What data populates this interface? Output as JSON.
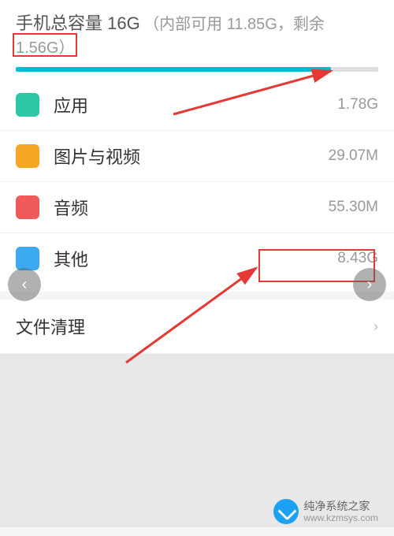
{
  "header": {
    "title": "手机总容量 16G",
    "sub_prefix": "（内部可用 ",
    "available": "11.85G",
    "sub_mid": "，剩余",
    "remaining": "1.56G",
    "sub_suffix": "）"
  },
  "progress": {
    "percent": 87
  },
  "categories": [
    {
      "label": "应用",
      "value": "1.78G",
      "color": "#2bc7a7"
    },
    {
      "label": "图片与视频",
      "value": "29.07M",
      "color": "#f5a623"
    },
    {
      "label": "音频",
      "value": "55.30M",
      "color": "#f05a5a"
    },
    {
      "label": "其他",
      "value": "8.43G",
      "color": "#3da9f0"
    }
  ],
  "cleanup": {
    "label": "文件清理"
  },
  "watermark": {
    "name": "纯净系统之家",
    "url": "www.kzmsys.com"
  }
}
